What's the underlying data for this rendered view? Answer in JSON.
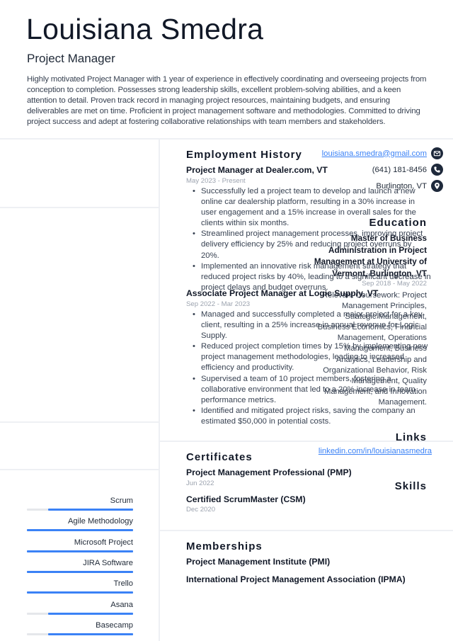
{
  "header": {
    "name": "Louisiana Smedra",
    "title": "Project Manager",
    "summary": "Highly motivated Project Manager with 1 year of experience in effectively coordinating and overseeing projects from conception to completion. Possesses strong leadership skills, excellent problem-solving abilities, and a keen attention to detail. Proven track record in managing project resources, maintaining budgets, and ensuring deliverables are met on time. Proficient in project management software and methodologies. Committed to driving project success and adept at fostering collaborative relationships with team members and stakeholders."
  },
  "contact": {
    "email": "louisiana.smedra@gmail.com",
    "phone": "(641) 181-8456",
    "location": "Burlington, VT",
    "icons": [
      "envelope-icon",
      "phone-icon",
      "map-pin-icon"
    ],
    "icon_color": "#1e293b"
  },
  "education": {
    "heading": "Education",
    "degree": "Master of Business Administration in Project Management at University of Vermont, Burlington, VT",
    "dates": "Sep 2018 - May 2022",
    "description": "Relevant Coursework: Project Management Principles, Strategic Management, Business Economics, Financial Management, Operations Management, Business Analytics, Leadership and Organizational Behavior, Risk Management, Quality Management, and Innovation Management."
  },
  "links": {
    "heading": "Links",
    "items": [
      "linkedin.com/in/louisianasmedra"
    ]
  },
  "skills": {
    "heading": "Skills",
    "accent_color": "#3b82f6",
    "items": [
      {
        "name": "Scrum",
        "level": 0.8
      },
      {
        "name": "Agile Methodology",
        "level": 1.0
      },
      {
        "name": "Microsoft Project",
        "level": 1.0
      },
      {
        "name": "JIRA Software",
        "level": 1.0
      },
      {
        "name": "Trello",
        "level": 1.0
      },
      {
        "name": "Asana",
        "level": 0.8
      },
      {
        "name": "Basecamp",
        "level": 0.8
      }
    ]
  },
  "employment": {
    "heading": "Employment History",
    "jobs": [
      {
        "title": "Project Manager at Dealer.com, VT",
        "dates": "May 2023 - Present",
        "bullets": [
          "Successfully led a project team to develop and launch a new online car dealership platform, resulting in a 30% increase in user engagement and a 15% increase in overall sales for the clients within six months.",
          "Streamlined project management processes, improving project delivery efficiency by 25% and reducing project overruns by 20%.",
          "Implemented an innovative risk management strategy that reduced project risks by 40%, leading to a significant decrease in project delays and budget overruns."
        ]
      },
      {
        "title": "Associate Project Manager at Logic Supply, VT",
        "dates": "Sep 2022 - Mar 2023",
        "bullets": [
          "Managed and successfully completed a major project for a key client, resulting in a 25% increase in annual revenue for Logic Supply.",
          "Reduced project completion times by 15% by implementing new project management methodologies, leading to increased efficiency and productivity.",
          "Supervised a team of 10 project members, fostering a collaborative environment that led to a 20% increase in team performance metrics.",
          "Identified and mitigated project risks, saving the company an estimated $50,000 in potential costs."
        ]
      }
    ]
  },
  "certificates": {
    "heading": "Certificates",
    "items": [
      {
        "name": "Project Management Professional (PMP)",
        "date": "Jun 2022"
      },
      {
        "name": "Certified ScrumMaster (CSM)",
        "date": "Dec 2020"
      }
    ]
  },
  "memberships": {
    "heading": "Memberships",
    "items": [
      "Project Management Institute (PMI)",
      "International Project Management Association (IPMA)"
    ]
  }
}
